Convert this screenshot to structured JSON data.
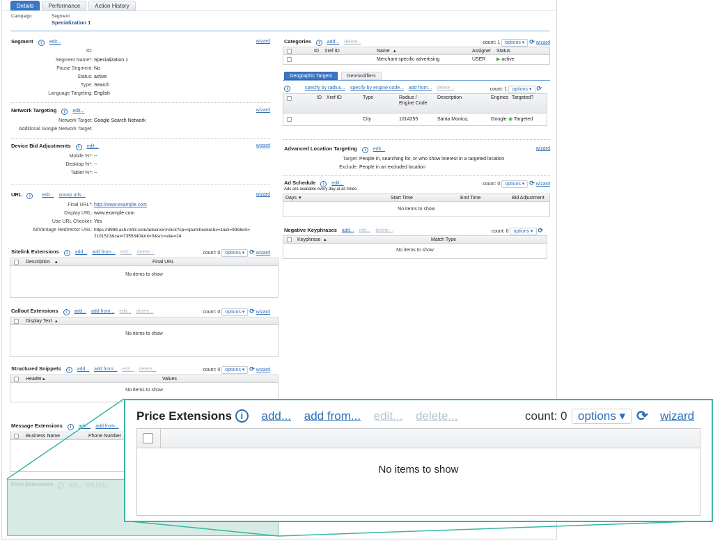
{
  "tabs": [
    "Details",
    "Performance",
    "Action History"
  ],
  "crumbs": {
    "campaign_label": "Campaign",
    "segment_label": "Segment",
    "segment_value": "Specialization 1"
  },
  "common": {
    "edit": "edit...",
    "wizard": "wizard",
    "add": "add...",
    "add_from": "add from...",
    "delete": "delete...",
    "options": "options",
    "count0": "count: 0",
    "count1": "count: 1",
    "no_items": "No items to show",
    "info": "i"
  },
  "segment": {
    "title": "Segment",
    "fields": [
      {
        "label": "ID:",
        "value": ""
      },
      {
        "label": "Segment Name*:",
        "value": "Specialization 1"
      },
      {
        "label": "Pause Segment:",
        "value": "No"
      },
      {
        "label": "Status:",
        "value": "active"
      },
      {
        "label": "Type:",
        "value": "Search"
      },
      {
        "label": "Language Targeting:",
        "value": "English"
      }
    ]
  },
  "network": {
    "title": "Network Targeting",
    "fields": [
      {
        "label": "Network Target:",
        "value": "Google Search Network"
      },
      {
        "label": "Additional Google Network Target:",
        "value": ""
      }
    ]
  },
  "device": {
    "title": "Device Bid Adjustments",
    "fields": [
      {
        "label": "Mobile %*:",
        "value": "--"
      },
      {
        "label": "Desktop %*:",
        "value": "--"
      },
      {
        "label": "Tablet %*:",
        "value": "--"
      }
    ]
  },
  "url": {
    "title": "URL",
    "snoop": "snoop urls...",
    "fields": [
      {
        "label": "Final URL*:",
        "value": "http://www.example.com",
        "link": true
      },
      {
        "label": "Display URL:",
        "value": "www.example.com"
      },
      {
        "label": "Use URL Checker:",
        "value": "Yes"
      },
      {
        "label": "AdVantage Redirector URL:",
        "value": "https://d999.ash.rd43.com/adserver/rclick?cp=ripurlchecker&v=1&cl=999&ml="
      },
      {
        "label": "",
        "value": "2101513&cat=7355340&mt=0&src=s&e=24"
      }
    ]
  },
  "sitelink": {
    "title": "Sitelink Extensions",
    "col1": "Description",
    "col2": "Final URL"
  },
  "callout": {
    "title": "Callout Extensions",
    "col1": "Display Text"
  },
  "snippets": {
    "title": "Structured Snippets",
    "col1": "Header",
    "col2": "Values"
  },
  "message": {
    "title": "Message Extensions",
    "col1": "Business Name",
    "col2": "Phone Number"
  },
  "price": {
    "title": "Price Extensions"
  },
  "categories": {
    "title": "Categories",
    "headers": [
      "ID",
      "Xref ID",
      "Name",
      "Assigner",
      "Status"
    ],
    "row": {
      "name": "Merchant specific advertising",
      "assigner": "USER",
      "status": "active"
    }
  },
  "geo": {
    "tabs": [
      "Geographic Targets",
      "Geomodifiers"
    ],
    "radius": "specify by radius...",
    "engine": "specify by engine code...",
    "headers": [
      "ID",
      "Xref ID",
      "Type",
      "Radius / Engine Code",
      "Description",
      "Engines",
      "Targeted?"
    ],
    "row": {
      "type": "City",
      "code": "1014255",
      "description": "Santa Monica,",
      "engines": "Google",
      "targeted": "Targeted"
    }
  },
  "advanced": {
    "title": "Advanced Location Targeting",
    "fields": [
      {
        "label": "Target:",
        "value": "People in, searching for, or who show interest in a targeted location"
      },
      {
        "label": "Exclude:",
        "value": "People in an excluded location"
      }
    ]
  },
  "schedule": {
    "title": "Ad Schedule",
    "note": "Ads are available every day at all times.",
    "headers": [
      "Days",
      "Start Time",
      "End Time",
      "Bid Adjustment"
    ]
  },
  "negative": {
    "title": "Negative Keyphrases",
    "headers": [
      "Keyphrase",
      "Match Type"
    ]
  },
  "colors": {
    "accent": "#3c76c6",
    "link": "#2c6fb7",
    "highlight": "#38b5a3",
    "active": "#3aa53a"
  }
}
